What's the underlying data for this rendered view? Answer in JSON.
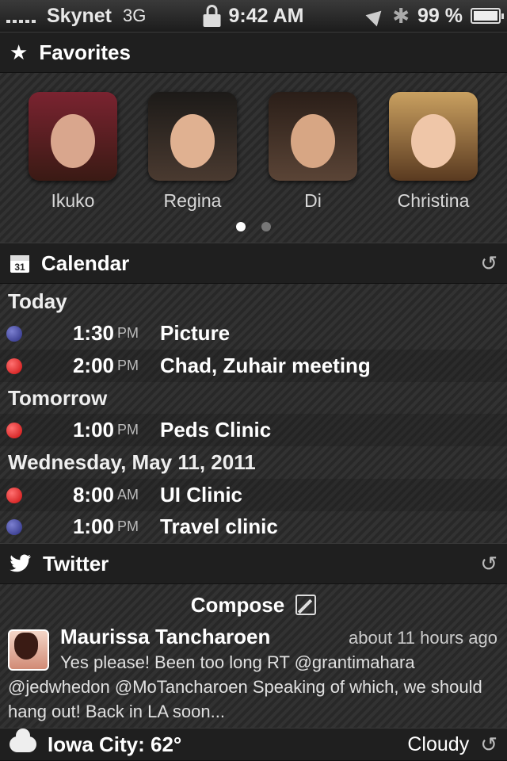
{
  "status": {
    "carrier": "Skynet",
    "network": "3G",
    "time": "9:42 AM",
    "battery": "99 %",
    "battery_level": 0.99,
    "icons": [
      "signal-icon",
      "lock-icon",
      "location-icon",
      "bluetooth-icon",
      "battery-icon"
    ]
  },
  "favorites": {
    "title": "Favorites",
    "icon": "star-icon",
    "people": [
      {
        "name": "Ikuko"
      },
      {
        "name": "Regina"
      },
      {
        "name": "Di"
      },
      {
        "name": "Christina"
      }
    ],
    "page_count": 2,
    "active_page": 1
  },
  "calendar": {
    "title": "Calendar",
    "icon": "calendar-icon",
    "icon_date": "31",
    "groups": [
      {
        "day": "Today",
        "events": [
          {
            "time": "1:30",
            "ampm": "PM",
            "title": "Picture",
            "color": "#3b3f9a"
          },
          {
            "time": "2:00",
            "ampm": "PM",
            "title": "Chad, Zuhair meeting",
            "color": "#e11c1c"
          }
        ]
      },
      {
        "day": "Tomorrow",
        "events": [
          {
            "time": "1:00",
            "ampm": "PM",
            "title": "Peds Clinic",
            "color": "#e11c1c"
          }
        ]
      },
      {
        "day": "Wednesday, May 11, 2011",
        "events": [
          {
            "time": "8:00",
            "ampm": "AM",
            "title": "UI Clinic",
            "color": "#e11c1c"
          },
          {
            "time": "1:00",
            "ampm": "PM",
            "title": "Travel clinic",
            "color": "#3b3f9a"
          }
        ]
      }
    ]
  },
  "twitter": {
    "title": "Twitter",
    "icon": "twitter-bird-icon",
    "compose_label": "Compose",
    "tweet": {
      "author": "Maurissa Tancharoen",
      "time": "about 11 hours ago",
      "text": "Yes please! Been too long RT @grantimahara @jedwhedon @MoTancharoen Speaking of which, we should hang out! Back in LA soon..."
    }
  },
  "weather": {
    "location": "Iowa City: 62°",
    "condition": "Cloudy",
    "icon": "cloud-icon"
  }
}
